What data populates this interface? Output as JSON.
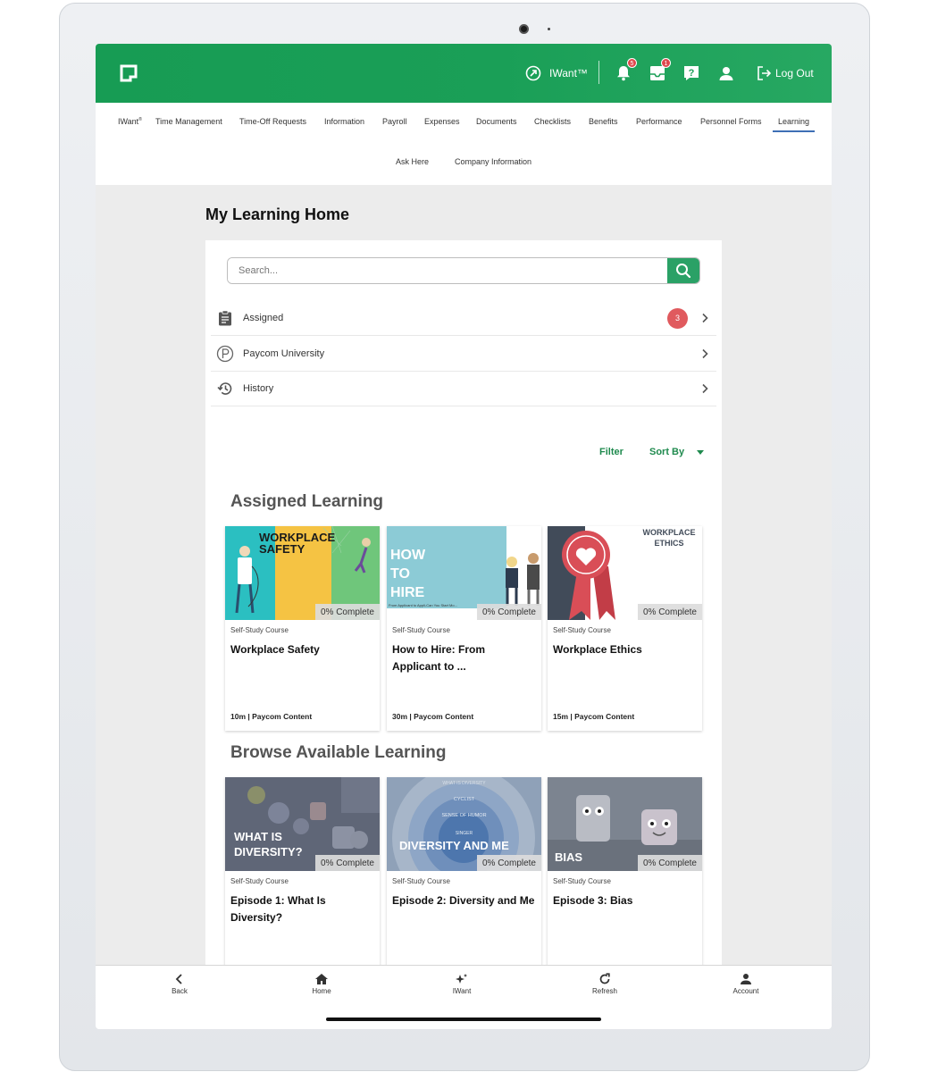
{
  "header": {
    "iwant_label": "IWant™",
    "bell_badge": "5",
    "inbox_badge": "1",
    "logout_label": "Log Out"
  },
  "nav": {
    "items": [
      "IWant",
      "Time Management",
      "Time-Off Requests",
      "Information",
      "Payroll",
      "Expenses",
      "Documents",
      "Checklists",
      "Benefits",
      "Performance",
      "Personnel Forms",
      "Learning",
      "Ask Here",
      "Company Information"
    ],
    "iwant_mark": "®",
    "active": "Learning"
  },
  "page": {
    "title": "My Learning Home"
  },
  "search": {
    "placeholder": "Search..."
  },
  "menu": [
    {
      "label": "Assigned",
      "badge": "3"
    },
    {
      "label": "Paycom University"
    },
    {
      "label": "History"
    }
  ],
  "controls": {
    "filter": "Filter",
    "sort": "Sort By"
  },
  "assigned": {
    "title": "Assigned Learning",
    "courses": [
      {
        "type": "Self-Study Course",
        "title": "Workplace Safety",
        "progress": "0% Complete",
        "meta": "10m | Paycom Content",
        "thumb_text": "WORKPLACE SAFETY"
      },
      {
        "type": "Self-Study Course",
        "title": "How to Hire: From Applicant to ...",
        "progress": "0% Complete",
        "meta": "30m | Paycom Content",
        "thumb_text": "HOW TO HIRE",
        "thumb_sub": "From Applicant to Appli-Can You Start Mo..."
      },
      {
        "type": "Self-Study Course",
        "title": "Workplace Ethics",
        "progress": "0% Complete",
        "meta": "15m | Paycom Content",
        "thumb_text": "WORKPLACE ETHICS"
      }
    ]
  },
  "browse": {
    "title": "Browse Available Learning",
    "courses": [
      {
        "type": "Self-Study Course",
        "title": "Episode 1: What Is Diversity?",
        "progress": "0% Complete",
        "thumb_text": "WHAT IS DIVERSITY?"
      },
      {
        "type": "Self-Study Course",
        "title": "Episode 2: Diversity and Me",
        "progress": "0% Complete",
        "thumb_text": "DIVERSITY AND ME",
        "thumb_rings": [
          "WHAT IS DIVERSITY",
          "CYCLIST",
          "SENSE OF HUMOR",
          "SINGER"
        ]
      },
      {
        "type": "Self-Study Course",
        "title": "Episode 3: Bias",
        "progress": "0% Complete",
        "thumb_text": "BIAS"
      }
    ]
  },
  "bottom_nav": [
    "Back",
    "Home",
    "IWant",
    "Refresh",
    "Account"
  ],
  "colors": {
    "brand_green": "#1a9f57",
    "badge_red": "#e05a5e",
    "link_green": "#1f8a4e",
    "active_underline": "#3e6fb5"
  }
}
